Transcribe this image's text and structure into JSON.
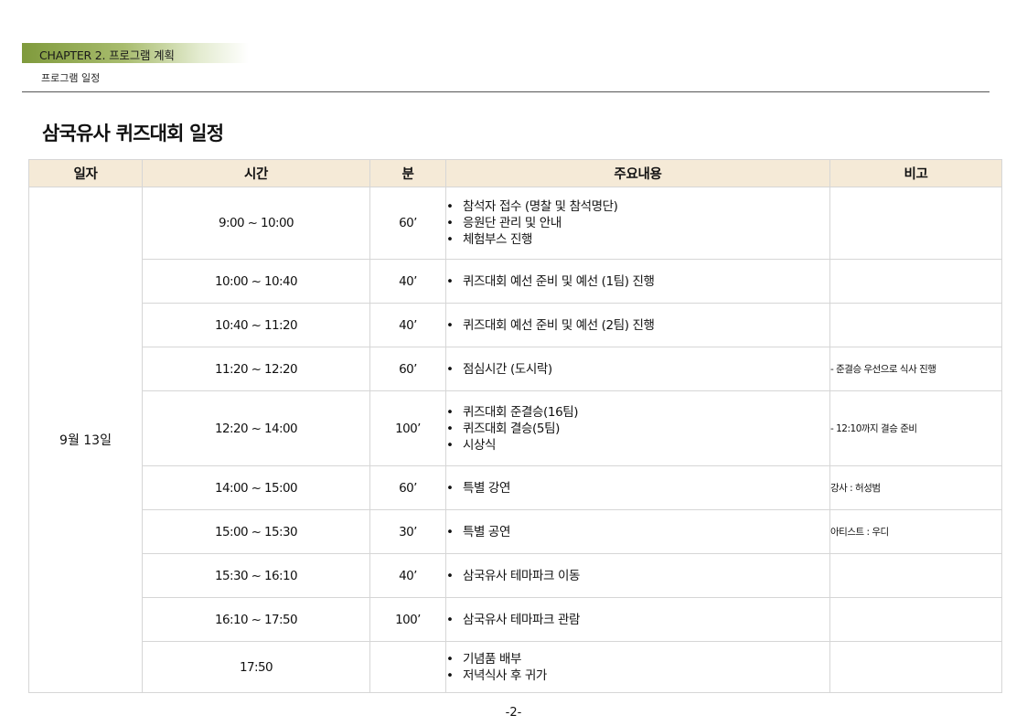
{
  "header": {
    "chapter": "CHAPTER 2. 프로그램 계획",
    "subtitle": "프로그램 일정",
    "accent": "#7f9a3c"
  },
  "page_title": "삼국유사 퀴즈대회 일정",
  "table": {
    "columns": [
      "일자",
      "시간",
      "분",
      "주요내용",
      "비고"
    ],
    "header_bg": "#f5ead7",
    "date": "9월 13일",
    "rows": [
      {
        "time": "9:00 ~ 10:00",
        "min": "60’",
        "items": [
          "참석자 접수 (명찰 및 참석명단)",
          "응원단 관리 및 안내",
          "체험부스 진행"
        ],
        "note": ""
      },
      {
        "time": "10:00 ~ 10:40",
        "min": "40’",
        "items": [
          "퀴즈대회 예선 준비 및 예선 (1팀) 진행"
        ],
        "note": ""
      },
      {
        "time": "10:40 ~ 11:20",
        "min": "40’",
        "items": [
          "퀴즈대회 예선 준비 및 예선 (2팀) 진행"
        ],
        "note": ""
      },
      {
        "time": "11:20 ~ 12:20",
        "min": "60’",
        "items": [
          "점심시간 (도시락)"
        ],
        "note": "- 준결승 우선으로 식사 진행"
      },
      {
        "time": "12:20 ~ 14:00",
        "min": "100’",
        "items": [
          "퀴즈대회 준결승(16팀)",
          "퀴즈대회 결승(5팀)",
          "시상식"
        ],
        "note": "- 12:10까지 결승 준비"
      },
      {
        "time": "14:00 ~ 15:00",
        "min": "60’",
        "items": [
          "특별 강연"
        ],
        "note": "강사 : 허성범"
      },
      {
        "time": "15:00 ~ 15:30",
        "min": "30’",
        "items": [
          "특별 공연"
        ],
        "note": "아티스트 : 우디"
      },
      {
        "time": "15:30 ~ 16:10",
        "min": "40’",
        "items": [
          "삼국유사 테마파크 이동"
        ],
        "note": ""
      },
      {
        "time": "16:10 ~ 17:50",
        "min": "100’",
        "items": [
          "삼국유사 테마파크 관람"
        ],
        "note": ""
      },
      {
        "time": "17:50",
        "min": "",
        "items": [
          "기념품 배부",
          "저녁식사 후 귀가"
        ],
        "note": ""
      }
    ]
  },
  "page_number": "-2-"
}
